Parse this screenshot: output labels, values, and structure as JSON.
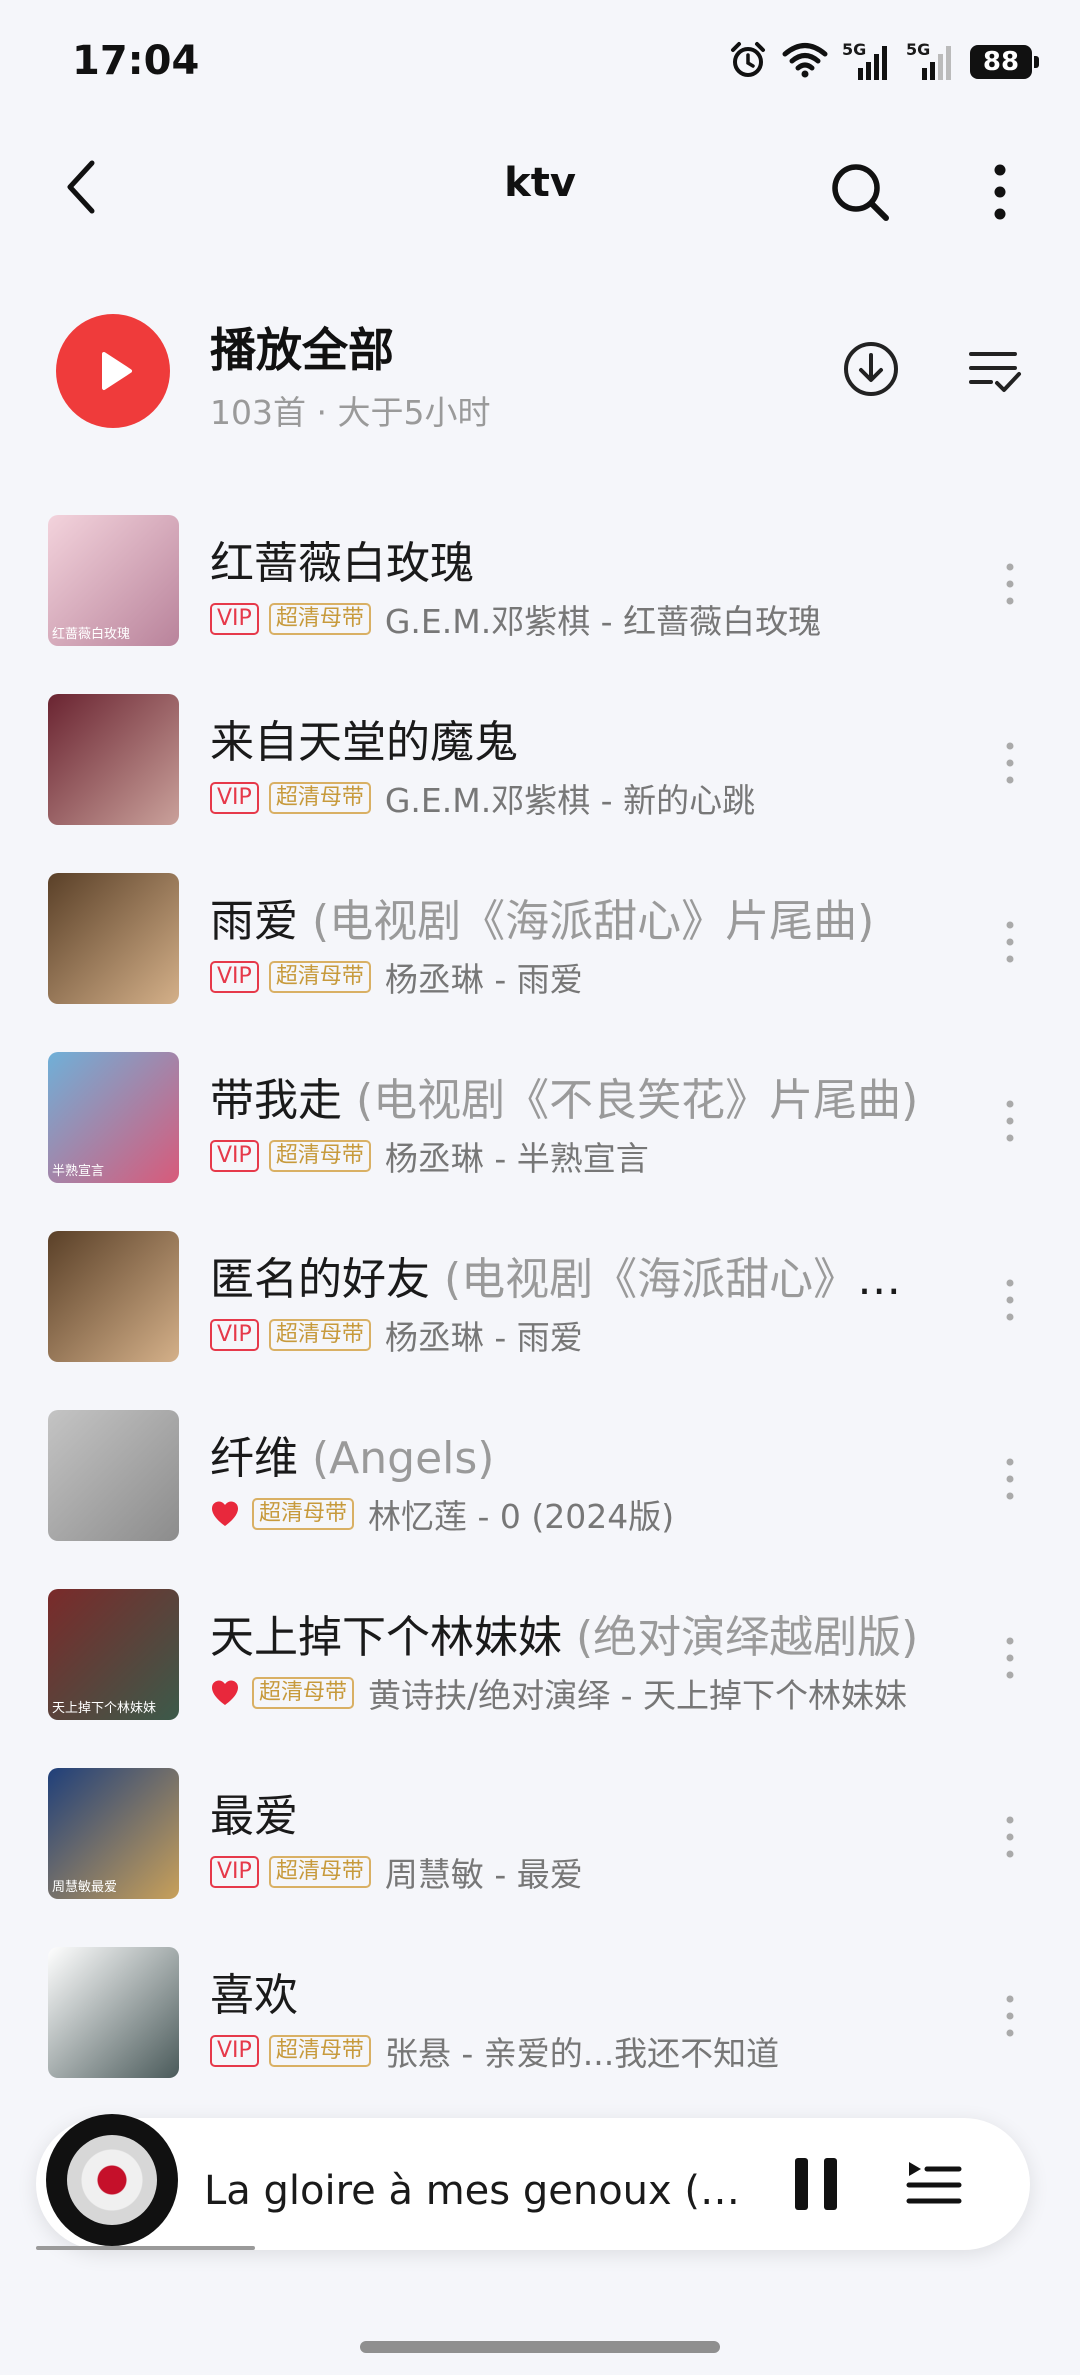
{
  "status": {
    "time": "17:04",
    "battery": "88",
    "net1": "5G",
    "net2": "5G"
  },
  "nav": {
    "title": "ktv"
  },
  "play_all": {
    "title": "播放全部",
    "subtitle": "103首 · 大于5小时"
  },
  "songs": [
    {
      "title": "红蔷薇白玫瑰",
      "subtitle": "",
      "badge1": "VIP",
      "badge2": "超清母带",
      "artist": "G.E.M.邓紫棋 - 红蔷薇白玫瑰",
      "cover_text": "红蔷薇白玫瑰",
      "cover_colors": [
        "#f3d3dc",
        "#b9839b"
      ]
    },
    {
      "title": "来自天堂的魔鬼",
      "subtitle": "",
      "badge1": "VIP",
      "badge2": "超清母带",
      "artist": "G.E.M.邓紫棋 - 新的心跳",
      "cover_text": "",
      "cover_colors": [
        "#6a2431",
        "#caa19b"
      ]
    },
    {
      "title": "雨爱",
      "subtitle": " (电视剧《海派甜心》片尾曲)",
      "badge1": "VIP",
      "badge2": "超清母带",
      "artist": "杨丞琳 - 雨爱",
      "cover_text": "",
      "cover_colors": [
        "#5a4028",
        "#d4b089"
      ]
    },
    {
      "title": "带我走",
      "subtitle": " (电视剧《不良笑花》片尾曲)",
      "badge1": "VIP",
      "badge2": "超清母带",
      "artist": "杨丞琳 - 半熟宣言",
      "cover_text": "半熟宣言",
      "cover_colors": [
        "#6fb0d8",
        "#d85a7a"
      ]
    },
    {
      "title": "匿名的好友",
      "subtitle": " (电视剧《海派甜心》插曲)",
      "badge1": "VIP",
      "badge2": "超清母带",
      "artist": "杨丞琳 - 雨爱",
      "cover_text": "",
      "cover_colors": [
        "#5a4028",
        "#d4b089"
      ]
    },
    {
      "title": "纤维",
      "subtitle": " (Angels)",
      "badge1": "heart",
      "badge2": "超清母带",
      "artist": "林忆莲 - 0 (2024版)",
      "cover_text": "",
      "cover_colors": [
        "#c4c4c4",
        "#8c8c8c"
      ]
    },
    {
      "title": "天上掉下个林妹妹",
      "subtitle": " (绝对演绎越剧版)",
      "badge1": "heart",
      "badge2": "超清母带",
      "artist": "黄诗扶/绝对演绎 - 天上掉下个林妹妹",
      "cover_text": "天上掉下个林妹妹",
      "cover_colors": [
        "#7a2a2a",
        "#3c5a4a"
      ]
    },
    {
      "title": "最爱",
      "subtitle": "",
      "badge1": "VIP",
      "badge2": "超清母带",
      "artist": "周慧敏 - 最爱",
      "cover_text": "周慧敏最爱",
      "cover_colors": [
        "#1f3f7a",
        "#c8a05a"
      ]
    },
    {
      "title": "喜欢",
      "subtitle": "",
      "badge1": "VIP",
      "badge2": "超清母带",
      "artist": "张悬 - 亲爱的...我还不知道",
      "cover_text": "",
      "cover_colors": [
        "#ffffff",
        "#4a5a5a"
      ]
    }
  ],
  "mini_player": {
    "title": "La gloire à mes genoux (荣耀在我膝下)",
    "progress": 0.22
  }
}
